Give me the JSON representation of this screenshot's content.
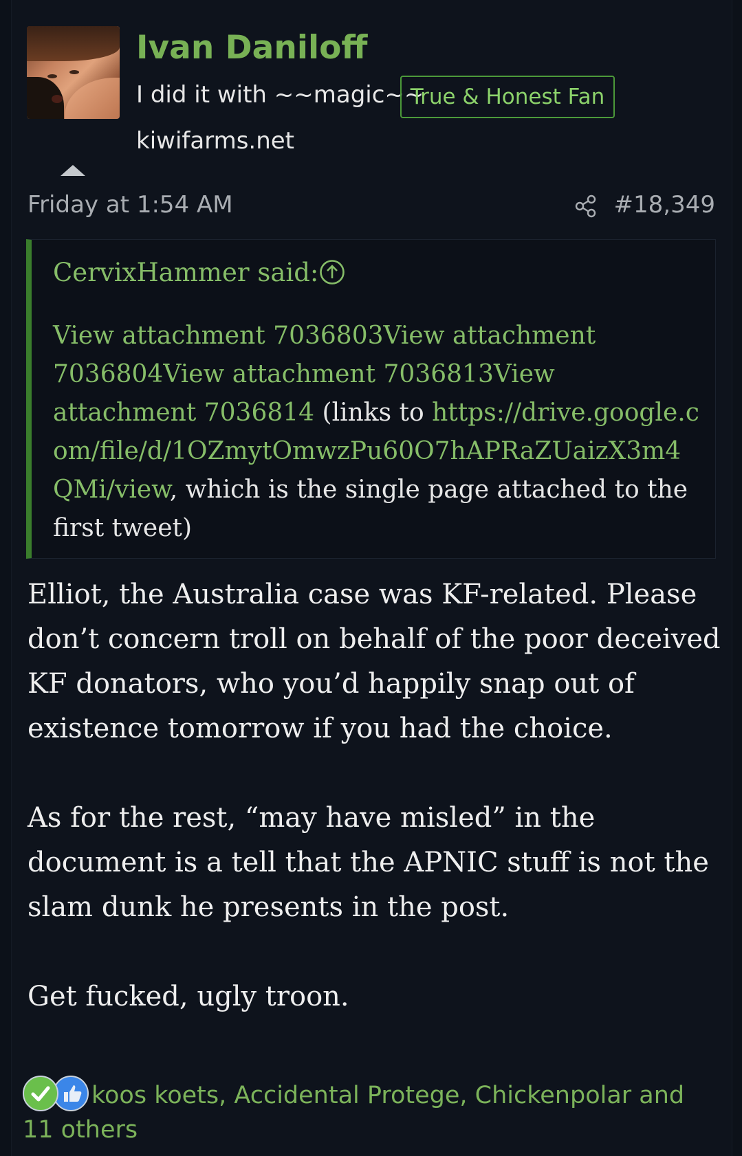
{
  "author": {
    "name": "Ivan Daniloff",
    "custom_title": "I did it with ~~magic~~",
    "badge": "True & Honest Fan",
    "site": "kiwifarms.net"
  },
  "post": {
    "date": "Friday at 1:54 AM",
    "number": "#18,349"
  },
  "quote": {
    "author_said": "CervixHammer said:",
    "att1": "View attachment 7036803",
    "att2": "View attachment 7036804",
    "att3": "View attachment 7036813",
    "att4": "View attachment 7036814",
    "text_links_to": " (links to ",
    "url": "https://drive.google.com/file/d/1OZmytOmwzPu60O7hAPRaZUaizX3m4QMi/view",
    "text_after": ", which is the single page attached to the first tweet)"
  },
  "message": {
    "paragraphs": [
      "Elliot, the Australia case was KF-related. Please don’t concern troll on behalf of the poor deceived KF donators, who you’d happily snap out of existence tomorrow if you had the choice.",
      "As for the rest, “may have misled” in the document is a tell that the APNIC stuff is not the slam dunk he presents in the post.",
      "Get fucked, ugly troon."
    ]
  },
  "reactions": {
    "text": "koos koets, Accidental Protege, Chickenpolar and 11 others",
    "icons": [
      "check-reaction-icon",
      "like-reaction-icon"
    ]
  },
  "colors": {
    "background": "#0e131c",
    "accent_green": "#78b155",
    "link_green": "#86bd68",
    "quote_bar": "#3a7d2c"
  }
}
